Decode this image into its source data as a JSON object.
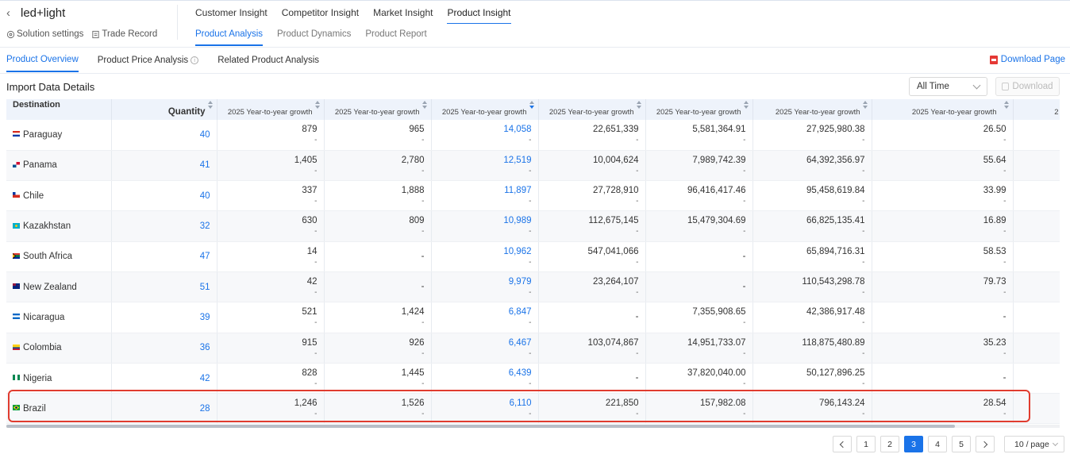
{
  "header": {
    "back_glyph": "‹",
    "solution_name": "led+light",
    "links": [
      {
        "label": "Solution settings",
        "icon": "gear-circle-icon"
      },
      {
        "label": "Trade Record",
        "icon": "document-icon"
      }
    ],
    "main_tabs": [
      "Customer Insight",
      "Competitor Insight",
      "Market Insight",
      "Product Insight"
    ],
    "main_active": "Product Insight",
    "sub_tabs": [
      "Product Analysis",
      "Product Dynamics",
      "Product Report"
    ],
    "sub_active": "Product Analysis"
  },
  "section_tabs": {
    "items": [
      "Product Overview",
      "Product Price Analysis",
      "Related Product Analysis"
    ],
    "active": "Product Overview",
    "info_glyph": "i",
    "download_page": "Download Page"
  },
  "panel": {
    "title": "Import Data Details",
    "time_filter": "All Time",
    "download": "Download"
  },
  "table": {
    "col_destination": "Destination",
    "col_quantity": "Quantity",
    "growth_label": "2025 Year-to-year growth",
    "growth_placeholder": "-",
    "last_col_fragment": "2",
    "rows": [
      {
        "flag": "paraguay",
        "dest": "Paraguay",
        "qty": "40",
        "c1": "879",
        "c2": "965",
        "c3": "14,058",
        "c4": "22,651,339",
        "c5": "5,581,364.91",
        "c6": "27,925,980.38",
        "c7": "26.50"
      },
      {
        "flag": "panama",
        "dest": "Panama",
        "qty": "41",
        "c1": "1,405",
        "c2": "2,780",
        "c3": "12,519",
        "c4": "10,004,624",
        "c5": "7,989,742.39",
        "c6": "64,392,356.97",
        "c7": "55.64"
      },
      {
        "flag": "chile",
        "dest": "Chile",
        "qty": "40",
        "c1": "337",
        "c2": "1,888",
        "c3": "11,897",
        "c4": "27,728,910",
        "c5": "96,416,417.46",
        "c6": "95,458,619.84",
        "c7": "33.99"
      },
      {
        "flag": "kazakhstan",
        "dest": "Kazakhstan",
        "qty": "32",
        "c1": "630",
        "c2": "809",
        "c3": "10,989",
        "c4": "112,675,145",
        "c5": "15,479,304.69",
        "c6": "66,825,135.41",
        "c7": "16.89"
      },
      {
        "flag": "south-africa",
        "dest": "South Africa",
        "qty": "47",
        "c1": "14",
        "c2": "-",
        "c3": "10,962",
        "c4": "547,041,066",
        "c5": "-",
        "c6": "65,894,716.31",
        "c7": "58.53"
      },
      {
        "flag": "new-zealand",
        "dest": "New Zealand",
        "qty": "51",
        "c1": "42",
        "c2": "-",
        "c3": "9,979",
        "c4": "23,264,107",
        "c5": "-",
        "c6": "110,543,298.78",
        "c7": "79.73"
      },
      {
        "flag": "nicaragua",
        "dest": "Nicaragua",
        "qty": "39",
        "c1": "521",
        "c2": "1,424",
        "c3": "6,847",
        "c4": "-",
        "c5": "7,355,908.65",
        "c6": "42,386,917.48",
        "c7": "-"
      },
      {
        "flag": "colombia",
        "dest": "Colombia",
        "qty": "36",
        "c1": "915",
        "c2": "926",
        "c3": "6,467",
        "c4": "103,074,867",
        "c5": "14,951,733.07",
        "c6": "118,875,480.89",
        "c7": "35.23"
      },
      {
        "flag": "nigeria",
        "dest": "Nigeria",
        "qty": "42",
        "c1": "828",
        "c2": "1,445",
        "c3": "6,439",
        "c4": "-",
        "c5": "37,820,040.00",
        "c6": "50,127,896.25",
        "c7": "-"
      },
      {
        "flag": "brazil",
        "dest": "Brazil",
        "qty": "28",
        "c1": "1,246",
        "c2": "1,526",
        "c3": "6,110",
        "c4": "221,850",
        "c5": "157,982.08",
        "c6": "796,143.24",
        "c7": "28.54"
      }
    ],
    "highlighted_row": "Brazil"
  },
  "pagination": {
    "pages": [
      "1",
      "2",
      "3",
      "4",
      "5"
    ],
    "current": "3",
    "page_size": "10 / page"
  },
  "colors": {
    "accent": "#1a73e8",
    "highlight": "#e03c2f",
    "header_bg": "#eef3fb"
  }
}
